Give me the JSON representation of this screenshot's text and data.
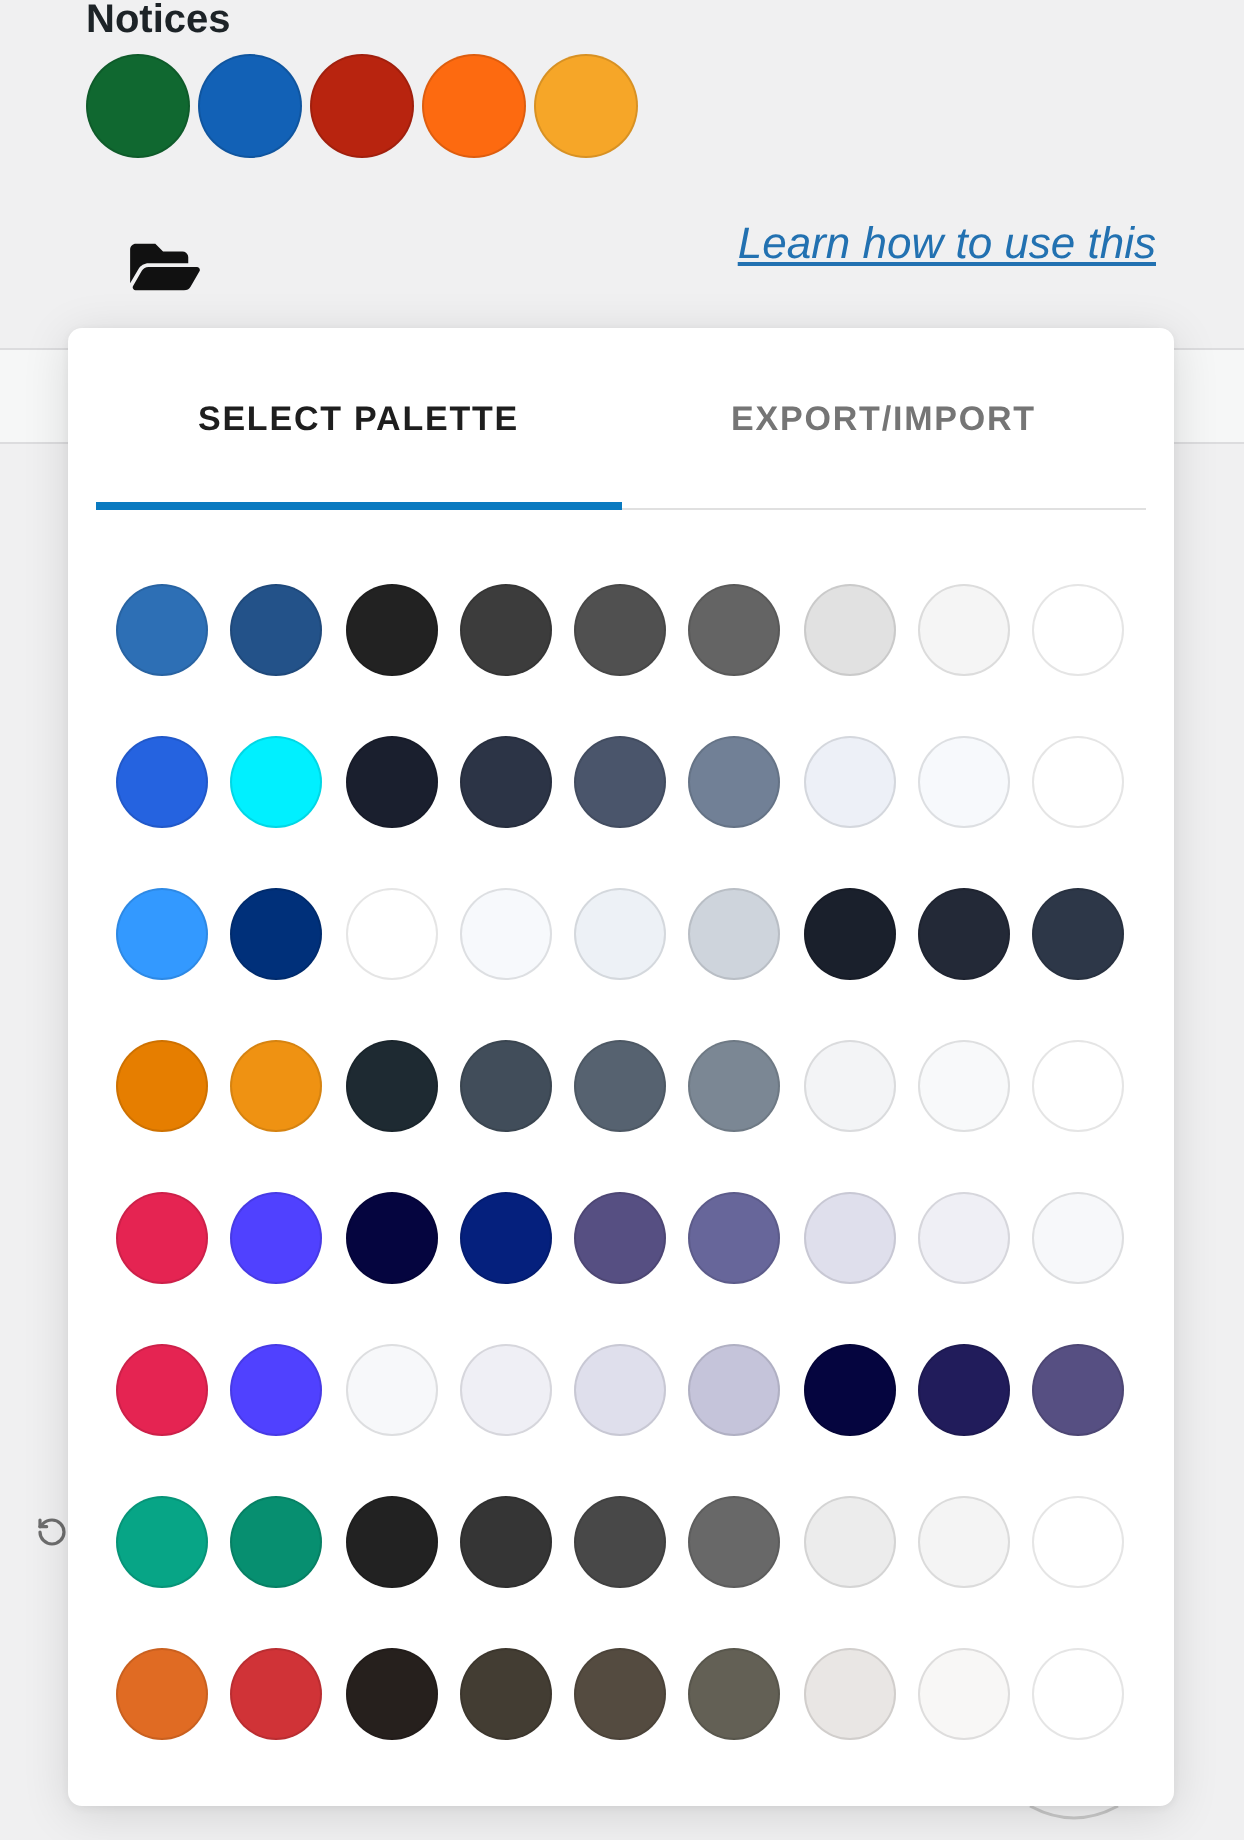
{
  "notices": {
    "heading": "Notices",
    "swatches": [
      {
        "color": "#106830"
      },
      {
        "color": "#1261b6"
      },
      {
        "color": "#b8240f"
      },
      {
        "color": "#fd6a10"
      },
      {
        "color": "#f6a628"
      }
    ]
  },
  "link": "Learn how to use this",
  "tabs": [
    {
      "label": "SELECT PALETTE",
      "selected": true
    },
    {
      "label": "EXPORT/IMPORT",
      "selected": false
    }
  ],
  "palettes": [
    {
      "swatches": [
        {
          "color": "#2d6fb5"
        },
        {
          "color": "#235289"
        },
        {
          "color": "#222222"
        },
        {
          "color": "#3c3c3c"
        },
        {
          "color": "#505050"
        },
        {
          "color": "#646464"
        },
        {
          "color": "#e1e1e1"
        },
        {
          "color": "#f5f5f5"
        },
        {
          "color": "#ffffff"
        }
      ]
    },
    {
      "swatches": [
        {
          "color": "#2563e0"
        },
        {
          "color": "#00f0ff"
        },
        {
          "color": "#1a1f2e"
        },
        {
          "color": "#2c3446"
        },
        {
          "color": "#4a556b"
        },
        {
          "color": "#718096"
        },
        {
          "color": "#edf0f7"
        },
        {
          "color": "#f7f9fc"
        },
        {
          "color": "#ffffff"
        }
      ]
    },
    {
      "swatches": [
        {
          "color": "#3399ff"
        },
        {
          "color": "#00307a"
        },
        {
          "color": "#ffffff"
        },
        {
          "color": "#f7f9fc"
        },
        {
          "color": "#edf1f6"
        },
        {
          "color": "#ced4dc"
        },
        {
          "color": "#1a202c"
        },
        {
          "color": "#232937"
        },
        {
          "color": "#2d3748"
        }
      ]
    },
    {
      "swatches": [
        {
          "color": "#e67e00"
        },
        {
          "color": "#ef9212"
        },
        {
          "color": "#1e2a32"
        },
        {
          "color": "#414d5a"
        },
        {
          "color": "#566270"
        },
        {
          "color": "#7b8794"
        },
        {
          "color": "#f3f4f6"
        },
        {
          "color": "#f8f9fa"
        },
        {
          "color": "#ffffff"
        }
      ]
    },
    {
      "swatches": [
        {
          "color": "#e52452"
        },
        {
          "color": "#5041ff"
        },
        {
          "color": "#05053f"
        },
        {
          "color": "#05207d"
        },
        {
          "color": "#564f82"
        },
        {
          "color": "#67669a"
        },
        {
          "color": "#dfdfec"
        },
        {
          "color": "#efeff5"
        },
        {
          "color": "#f7f8fa"
        }
      ]
    },
    {
      "swatches": [
        {
          "color": "#e52452"
        },
        {
          "color": "#5041ff"
        },
        {
          "color": "#f7f8fa"
        },
        {
          "color": "#efeff5"
        },
        {
          "color": "#dfdfec"
        },
        {
          "color": "#c5c4da"
        },
        {
          "color": "#05053f"
        },
        {
          "color": "#211c5b"
        },
        {
          "color": "#564f82"
        }
      ]
    },
    {
      "swatches": [
        {
          "color": "#07a586"
        },
        {
          "color": "#078f70"
        },
        {
          "color": "#222222"
        },
        {
          "color": "#353535"
        },
        {
          "color": "#484848"
        },
        {
          "color": "#686868"
        },
        {
          "color": "#ececec"
        },
        {
          "color": "#f4f4f4"
        },
        {
          "color": "#ffffff"
        }
      ]
    },
    {
      "swatches": [
        {
          "color": "#e06b23"
        },
        {
          "color": "#d03337"
        },
        {
          "color": "#26201d"
        },
        {
          "color": "#433d33"
        },
        {
          "color": "#544b40"
        },
        {
          "color": "#636055"
        },
        {
          "color": "#e9e6e4"
        },
        {
          "color": "#f8f7f6"
        },
        {
          "color": "#ffffff"
        }
      ]
    }
  ]
}
